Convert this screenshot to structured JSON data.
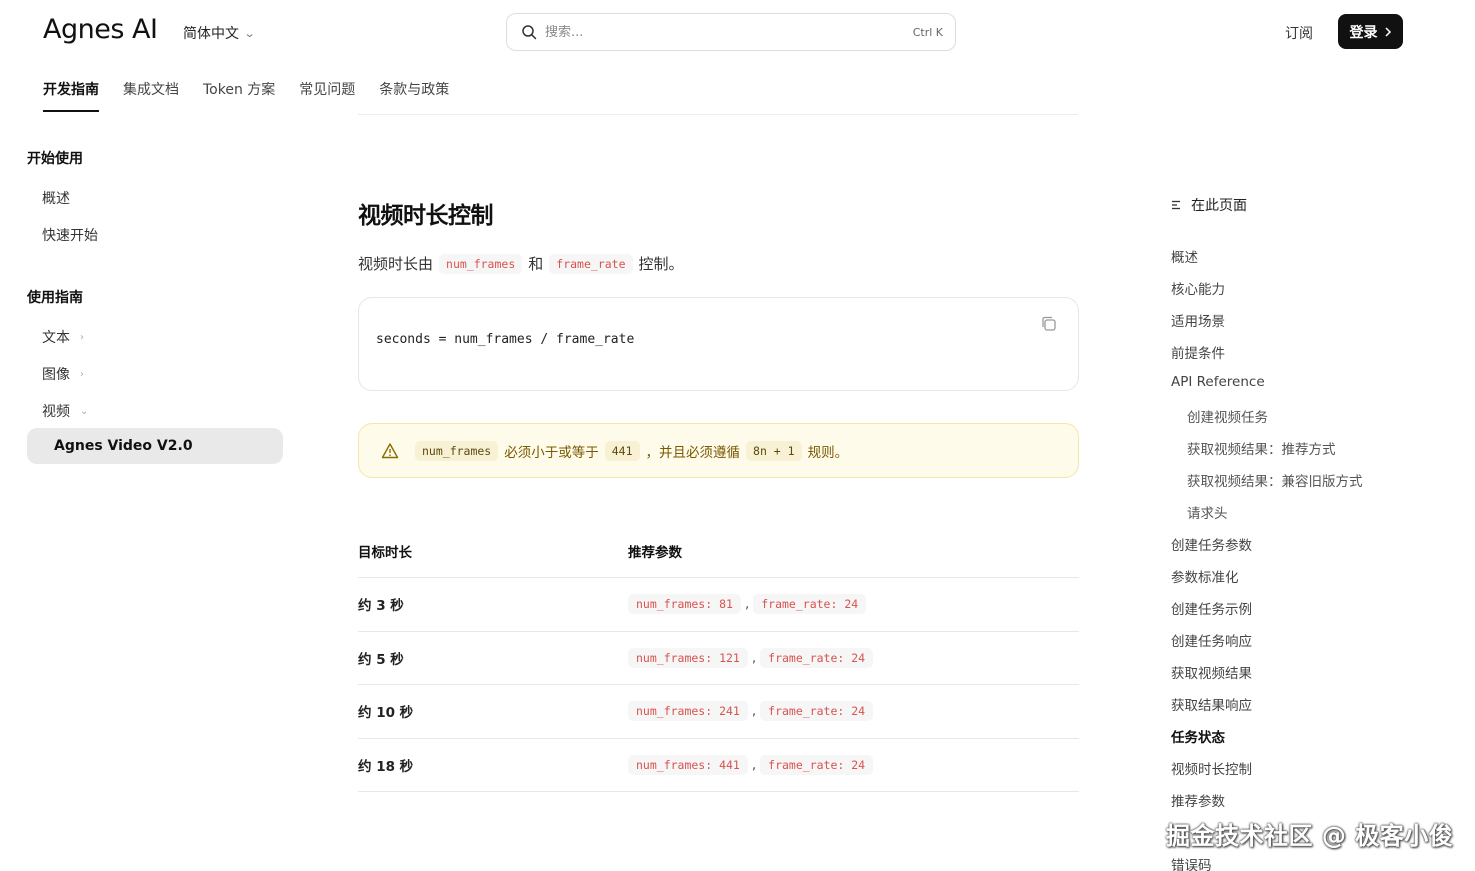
{
  "header": {
    "logo": "Agnes AI",
    "language": "简体中文",
    "search_placeholder": "搜索...",
    "search_shortcut": "Ctrl K",
    "subscribe": "订阅",
    "login": "登录"
  },
  "tabs": [
    "开发指南",
    "集成文档",
    "Token 方案",
    "常见问题",
    "条款与政策"
  ],
  "sidebar": {
    "section1": "开始使用",
    "section1_items": [
      "概述",
      "快速开始"
    ],
    "section2": "使用指南",
    "section2_items": [
      "文本",
      "图像",
      "视频"
    ],
    "active_item": "Agnes Video V2.0"
  },
  "main": {
    "title": "视频时长控制",
    "para_prefix": "视频时长由",
    "para_code1": "num_frames",
    "para_mid": "和",
    "para_code2": "frame_rate",
    "para_suffix": "控制。",
    "code_block": "seconds = num_frames / frame_rate",
    "warning": {
      "code1": "num_frames",
      "text1": "必须小于或等于",
      "code2": "441",
      "text2": "，并且必须遵循",
      "code3": "8n + 1",
      "text3": "规则。"
    },
    "table": {
      "headers": [
        "目标时长",
        "推荐参数"
      ],
      "rows": [
        {
          "duration": "约 3 秒",
          "p1": "num_frames: 81",
          "p2": "frame_rate: 24"
        },
        {
          "duration": "约 5 秒",
          "p1": "num_frames: 121",
          "p2": "frame_rate: 24"
        },
        {
          "duration": "约 10 秒",
          "p1": "num_frames: 241",
          "p2": "frame_rate: 24"
        },
        {
          "duration": "约 18 秒",
          "p1": "num_frames: 441",
          "p2": "frame_rate: 24"
        }
      ],
      "separator": ","
    }
  },
  "toc": {
    "heading": "在此页面",
    "items": [
      {
        "label": "概述",
        "level": 1
      },
      {
        "label": "核心能力",
        "level": 1
      },
      {
        "label": "适用场景",
        "level": 1
      },
      {
        "label": "前提条件",
        "level": 1
      },
      {
        "label": "API Reference",
        "level": 1
      },
      {
        "label": "创建视频任务",
        "level": 2
      },
      {
        "label": "获取视频结果：推荐方式",
        "level": 2
      },
      {
        "label": "获取视频结果：兼容旧版方式",
        "level": 2
      },
      {
        "label": "请求头",
        "level": 2
      },
      {
        "label": "创建任务参数",
        "level": 1
      },
      {
        "label": "参数标准化",
        "level": 1
      },
      {
        "label": "创建任务示例",
        "level": 1
      },
      {
        "label": "创建任务响应",
        "level": 1
      },
      {
        "label": "获取视频结果",
        "level": 1
      },
      {
        "label": "获取结果响应",
        "level": 1
      },
      {
        "label": "任务状态",
        "level": 1,
        "bold": true
      },
      {
        "label": "视频时长控制",
        "level": 1
      },
      {
        "label": "推荐参数",
        "level": 1
      },
      {
        "label": "错误码",
        "level": 1
      }
    ]
  },
  "watermark": "掘金技术社区 @ 极客小俊"
}
